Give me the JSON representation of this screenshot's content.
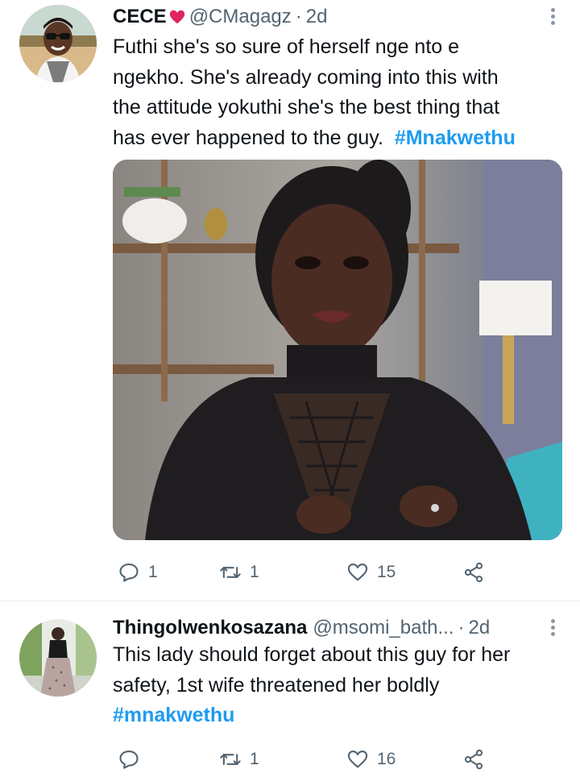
{
  "tweets": [
    {
      "author_name": "CECE",
      "handle": "@CMagagz",
      "separator": "·",
      "time": "2d",
      "text_lines": [
        "Futhi she's so sure of herself nge nto e",
        "ngekho. She's already coming into this with",
        "the attitude yokuthi she's the best thing that",
        "has ever happened to the guy."
      ],
      "hashtag": "#Mnakwethu",
      "reply_count": "1",
      "retweet_count": "1",
      "like_count": "15",
      "accent_color": "#1d9bf0"
    },
    {
      "author_name": "Thingolwenkosazana",
      "handle": "@msomi_bath...",
      "separator": "·",
      "time": "2d",
      "text_lines": [
        "This lady should forget about this guy for her",
        "safety, 1st wife threatened her boldly"
      ],
      "hashtag": "#mnakwethu",
      "reply_count": "",
      "retweet_count": "1",
      "like_count": "16",
      "accent_color": "#1d9bf0"
    }
  ],
  "icons": {
    "reply": "comment-icon",
    "retweet": "retweet-icon",
    "like": "heart-outline-icon",
    "share": "share-icon",
    "more": "more-vertical-icon"
  }
}
